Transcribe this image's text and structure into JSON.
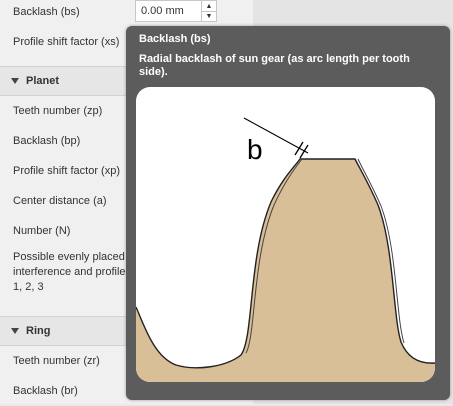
{
  "panel": {
    "backlash_bs_label": "Backlash (bs)",
    "backlash_bs_value": "0.00 mm",
    "profile_shift_xs_label": "Profile shift factor (xs)",
    "planet_section_title": "Planet",
    "teeth_zp_label": "Teeth number (zp)",
    "backlash_bp_label": "Backlash (bp)",
    "profile_shift_xp_label": "Profile shift  factor (xp)",
    "center_distance_label": "Center distance (a)",
    "number_label": "Number (N)",
    "possible_line1": "Possible evenly placed",
    "possible_line2": "interference and profile",
    "possible_line3": "1, 2, 3",
    "ring_section_title": "Ring",
    "teeth_zr_label": "Teeth number (zr)",
    "backlash_br_label": "Backlash (br)"
  },
  "tooltip": {
    "title": "Backlash (bs)",
    "description": "Radial backlash of sun gear (as arc length per tooth side).",
    "diagram_label": "b"
  },
  "colors": {
    "panel_bg": "#f0f0f0",
    "tooltip_bg": "#5c5c5c",
    "tooth_fill": "#d9bf98"
  },
  "icons": {
    "spin_up": "up-arrow-icon",
    "spin_down": "down-arrow-icon",
    "collapse": "triangle-down-icon"
  }
}
